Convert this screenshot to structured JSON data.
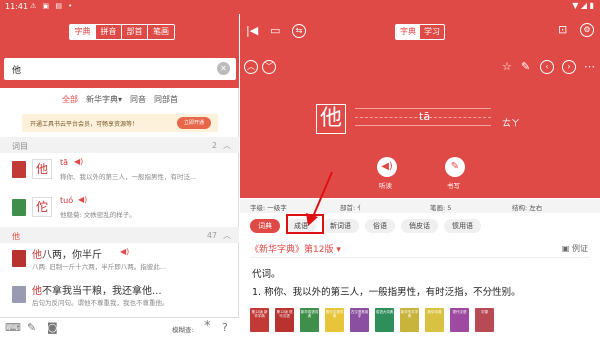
{
  "status_bar": {
    "time": "11:41",
    "notif_icons": "⚠ ▣ ▤ •",
    "system_icons": "▼ ◢ ▮"
  },
  "left": {
    "tabs": [
      {
        "label": "字典"
      },
      {
        "label": "拼音"
      },
      {
        "label": "部首"
      },
      {
        "label": "笔画"
      }
    ],
    "search": {
      "value": "他"
    },
    "filters": {
      "all": "全部",
      "dict": "新华字典",
      "homophone": "同音",
      "radical": "同部首"
    },
    "promo": {
      "text": "开通工具书云平台会员，可畅享资源等！",
      "button": "立即开通"
    },
    "sections": [
      {
        "label": "词目",
        "count": "2"
      },
      {
        "label": "他",
        "count": "47"
      }
    ],
    "entries": [
      {
        "char": "他",
        "pinyin": "tā",
        "def": "称你、我以外的第三人，一般指男性，有时泛..."
      },
      {
        "char": "佗",
        "pinyin": "tuó",
        "def": "他稳菊: 文帙密乱的样子。"
      }
    ],
    "phrases": [
      {
        "prefix": "他",
        "rest": "八两，你半斤",
        "sub": "八两: 旧制一斤十六两，半斤即八两。指彼此..."
      },
      {
        "prefix": "他",
        "rest": "不拿我当干粮，我还拿他...",
        "sub": "后句为反问句。谓他不尊重我，我也不尊重他。"
      }
    ],
    "footer": {
      "mode_label": "模糊查:"
    }
  },
  "right": {
    "tabs": [
      {
        "label": "字典"
      },
      {
        "label": "学习"
      }
    ],
    "char": "他",
    "pinyin": "tā",
    "zhuyin": "ㄊㄚ",
    "listen_label": "听读",
    "write_label": "书写",
    "props": {
      "level": "字级: 一级字",
      "radical": "部首: 亻",
      "strokes": "笔画: 5",
      "structure": "结构: 左右"
    },
    "panel_tabs": [
      {
        "label": "词典"
      },
      {
        "label": "成语"
      },
      {
        "label": "新词语"
      },
      {
        "label": "俗语"
      },
      {
        "label": "俏皮话"
      },
      {
        "label": "惯用语"
      }
    ],
    "dict_source": "《新华字典》第12版 ▾",
    "example_label": "例证",
    "defs": [
      "代词。",
      "1. 称你、我以外的第三人，一般指男性，有时泛指，不分性别。"
    ],
    "books": [
      {
        "title": "第12版 新华字典",
        "color": "#c23a36"
      },
      {
        "title": "第12版 现代汉语",
        "color": "#b8332f"
      },
      {
        "title": "新华成语词典",
        "color": "#3f8f4a"
      },
      {
        "title": "现代汉语词典",
        "color": "#e8c43a"
      },
      {
        "title": "古汉语常用字",
        "color": "#8a4fa0"
      },
      {
        "title": "成语大词典",
        "color": "#2e8f5a"
      },
      {
        "title": "新华写字字典",
        "color": "#c9b43b"
      },
      {
        "title": "新华字典",
        "color": "#d9c241"
      },
      {
        "title": "现代汉语",
        "color": "#9d4aa0"
      },
      {
        "title": "字源",
        "color": "#b84a55"
      }
    ]
  }
}
